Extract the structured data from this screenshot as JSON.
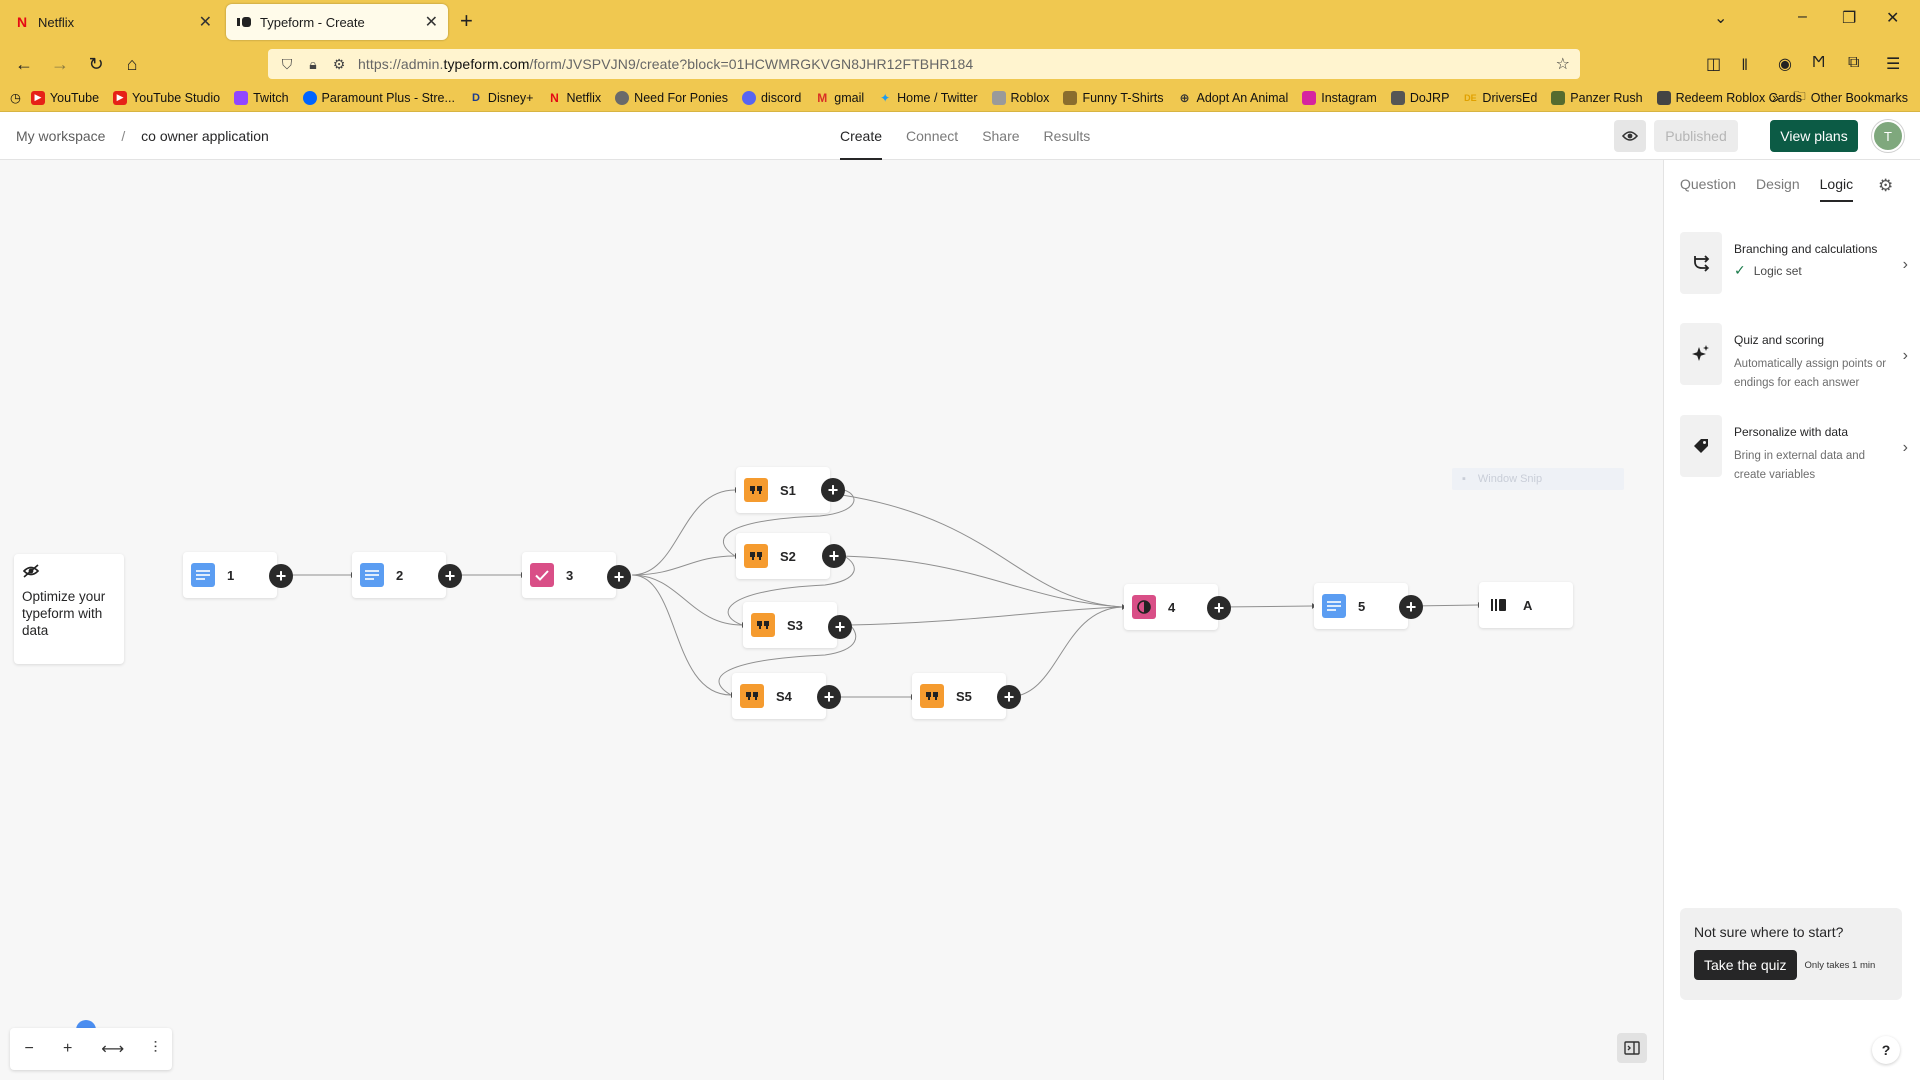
{
  "browser": {
    "tabs": [
      {
        "title": "Netflix",
        "active": false
      },
      {
        "title": "Typeform - Create",
        "active": true
      }
    ],
    "url_prefix": "https://admin.",
    "url_domain": "typeform.com",
    "url_rest": "/form/JVSPVJN9/create?block=01HCWMRGKVGN8JHR12FTBHR184",
    "bookmarks": [
      {
        "label": "YouTube",
        "color": "#e62117"
      },
      {
        "label": "YouTube Studio",
        "color": "#e62117"
      },
      {
        "label": "Twitch",
        "color": "#9146ff"
      },
      {
        "label": "Paramount Plus - Stre...",
        "color": "#0064ff"
      },
      {
        "label": "Disney+",
        "color": "#1b3c8f"
      },
      {
        "label": "Netflix",
        "color": "#e50914"
      },
      {
        "label": "Need For Ponies",
        "color": "#6a6a6a"
      },
      {
        "label": "discord",
        "color": "#5865f2"
      },
      {
        "label": "gmail",
        "color": "#d93025"
      },
      {
        "label": "Home / Twitter",
        "color": "#1d9bf0"
      },
      {
        "label": "Roblox",
        "color": "#777777"
      },
      {
        "label": "Funny T-Shirts",
        "color": "#8a6d2e"
      },
      {
        "label": "Adopt An Animal",
        "color": "#333333"
      },
      {
        "label": "Instagram",
        "color": "#d6249f"
      },
      {
        "label": "DoJRP",
        "color": "#555555"
      },
      {
        "label": "DriversEd",
        "color": "#e0a100"
      },
      {
        "label": "Panzer Rush",
        "color": "#556b2f"
      },
      {
        "label": "Redeem Roblox Cards",
        "color": "#444444"
      }
    ],
    "other_bookmarks": "Other Bookmarks"
  },
  "header": {
    "workspace": "My workspace",
    "separator": "/",
    "form_name": "co owner application",
    "tabs": [
      "Create",
      "Connect",
      "Share",
      "Results"
    ],
    "published_label": "Published",
    "view_plans_label": "View plans",
    "avatar_initial": "T"
  },
  "canvas": {
    "tip_text": "Optimize your typeform with data",
    "nodes": {
      "n1": "1",
      "n2": "2",
      "n3": "3",
      "s1": "S1",
      "s2": "S2",
      "s3": "S3",
      "s4": "S4",
      "s5": "S5",
      "n4": "4",
      "n5": "5",
      "na": "A"
    },
    "snip_label": "Window Snip"
  },
  "panel": {
    "tabs": [
      "Question",
      "Design",
      "Logic"
    ],
    "cards": [
      {
        "title": "Branching and calculations",
        "status": "Logic set"
      },
      {
        "title": "Quiz and scoring",
        "desc": "Automatically assign points or endings for each answer"
      },
      {
        "title": "Personalize with data",
        "desc": "Bring in external data and create variables"
      }
    ],
    "quiz_prompt": "Not sure where to start?",
    "quiz_button": "Take the quiz",
    "quiz_note": "Only takes 1 min",
    "help": "?"
  },
  "colors": {
    "chrome": "#f0c850",
    "accent_green": "#0c5b45",
    "node_blue": "#5b9df2",
    "node_pink": "#d94f87",
    "node_orange": "#f59b2f"
  }
}
